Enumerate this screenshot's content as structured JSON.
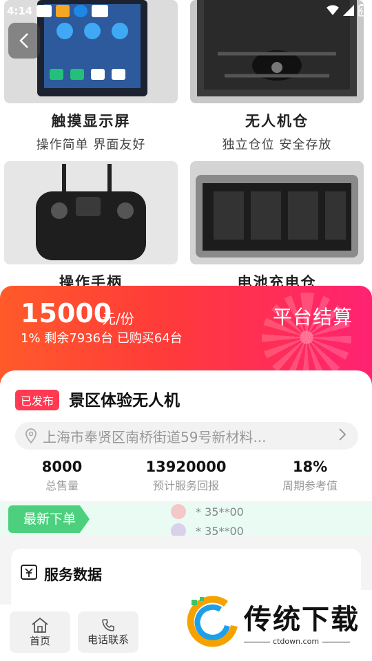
{
  "status_bar": {
    "time": "4:14"
  },
  "products": [
    {
      "title": "触摸显示屏",
      "subtitle": "操作简单 界面友好"
    },
    {
      "title": "无人机仓",
      "subtitle": "独立仓位 安全存放"
    },
    {
      "title": "操作手柄",
      "subtitle": ""
    },
    {
      "title": "电池充电仓",
      "subtitle": ""
    }
  ],
  "price": {
    "amount": "15000",
    "unit": "元/份",
    "meta": "1% 剩余7936台 已购买64台",
    "action": "平台结算"
  },
  "item": {
    "badge": "已发布",
    "title": "景区体验无人机",
    "address": "上海市奉贤区南桥街道59号新材料...",
    "stats": [
      {
        "value": "8000",
        "label": "总售量"
      },
      {
        "value": "13920000",
        "label": "预计服务回报"
      },
      {
        "value": "18%",
        "label": "周期参考值"
      }
    ]
  },
  "ticker": {
    "tag": "最新下单",
    "rows": [
      "* 35**00",
      "* 35**00"
    ]
  },
  "service": {
    "title": "服务数据"
  },
  "nav": {
    "home": "首页",
    "phone": "电话联系"
  },
  "watermark": {
    "name": "传统下载",
    "url": "ctdown.com"
  }
}
